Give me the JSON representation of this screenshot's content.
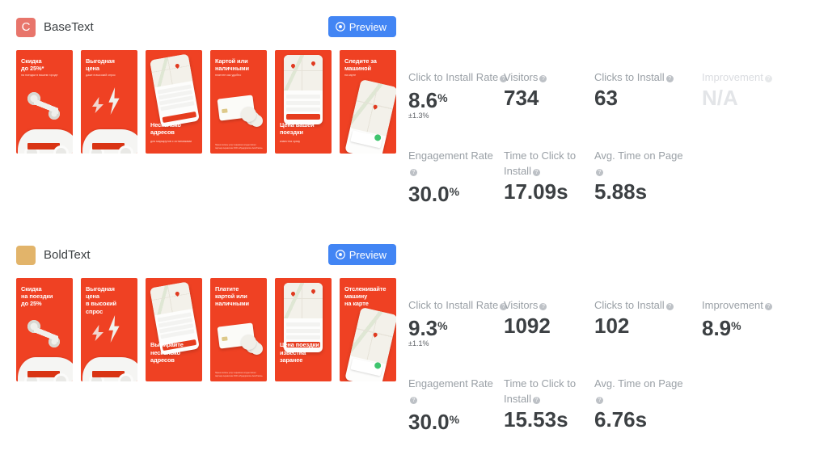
{
  "colors": {
    "accent_blue": "#4285f4",
    "label_gray": "#9aa0a6",
    "value_gray": "#3c4043",
    "na_gray": "#e3e5e8",
    "brand_red": "#ef4123",
    "avatar_base": "#e8756b",
    "avatar_bold": "#e2b46a"
  },
  "preview_label": "Preview",
  "qmark": "?",
  "variants": [
    {
      "id": "basetext",
      "name": "BaseText",
      "avatar_letter": "C",
      "avatar_color": "#e8756b",
      "shots": [
        {
          "headline": "Скидка\nдо 25%*",
          "sub": "на поездки в вашем городе",
          "pos": "top"
        },
        {
          "headline": "Выгодная\nцена",
          "sub": "даже в высокий спрос",
          "pos": "top"
        },
        {
          "headline": "Несколько\nадресов",
          "sub": "для маршрутов с остановками",
          "pos": "bottom"
        },
        {
          "headline": "Картой или\nналичными",
          "sub": "платите как удобно",
          "pos": "top",
          "legal": "Прием оплаты услуг перевозки осуществляет партнер-перевозчик ООО «Предприятие АвтоТакси»"
        },
        {
          "headline": "Цена вашей\nпоездки",
          "sub": "известна сразу",
          "pos": "bottom"
        },
        {
          "headline": "Следите за\nмашиной",
          "sub": "на карте",
          "pos": "top"
        }
      ],
      "metrics": [
        {
          "key": "click_to_install_rate",
          "label": "Click to Install Rate",
          "value": "8.6",
          "unit": "%",
          "error": "±1.3%",
          "wide": true,
          "na": false,
          "col": 0,
          "row": 0
        },
        {
          "key": "visitors",
          "label": "Visitors",
          "value": "734",
          "unit": "",
          "error": "",
          "wide": false,
          "na": false,
          "col": 1,
          "row": 0
        },
        {
          "key": "clicks_to_install",
          "label": "Clicks to Install",
          "value": "63",
          "unit": "",
          "error": "",
          "wide": false,
          "na": false,
          "col": 2,
          "row": 0
        },
        {
          "key": "improvement",
          "label": "Improvement",
          "value": "N/A",
          "unit": "",
          "error": "",
          "wide": true,
          "na": true,
          "col": 3,
          "row": 0
        },
        {
          "key": "engagement_rate",
          "label": "Engagement Rate",
          "value": "30.0",
          "unit": "%",
          "error": "",
          "wide": false,
          "na": false,
          "col": 0,
          "row": 1
        },
        {
          "key": "time_to_click_to_install",
          "label": "Time to Click to Install",
          "value": "17.09s",
          "unit": "",
          "error": "",
          "wide": false,
          "na": false,
          "col": 1,
          "row": 1
        },
        {
          "key": "avg_time_on_page",
          "label": "Avg. Time on Page",
          "value": "5.88s",
          "unit": "",
          "error": "",
          "wide": false,
          "na": false,
          "col": 2,
          "row": 1
        }
      ]
    },
    {
      "id": "boldtext",
      "name": "BoldText",
      "avatar_letter": "",
      "avatar_color": "#e2b46a",
      "shots": [
        {
          "headline": "Скидка\nна поездки\nдо 25%",
          "sub": "",
          "pos": "top"
        },
        {
          "headline": "Выгодная\nцена\nв высокий\nспрос",
          "sub": "",
          "pos": "top"
        },
        {
          "headline": "Выбирайте\nнесколько\nадресов",
          "sub": "",
          "pos": "bottom"
        },
        {
          "headline": "Платите\nкартой или\nналичными",
          "sub": "",
          "pos": "top",
          "legal": "Прием оплаты услуг перевозки осуществляет партнер-перевозчик ООО «Предприятие АвтоТакси»"
        },
        {
          "headline": "Цена поездки\nизвестна\nзаранее",
          "sub": "",
          "pos": "bottom"
        },
        {
          "headline": "Отслеживайте\nмашину\nна карте",
          "sub": "",
          "pos": "top"
        }
      ],
      "metrics": [
        {
          "key": "click_to_install_rate",
          "label": "Click to Install Rate",
          "value": "9.3",
          "unit": "%",
          "error": "±1.1%",
          "wide": true,
          "na": false,
          "col": 0,
          "row": 0
        },
        {
          "key": "visitors",
          "label": "Visitors",
          "value": "1092",
          "unit": "",
          "error": "",
          "wide": false,
          "na": false,
          "col": 1,
          "row": 0
        },
        {
          "key": "clicks_to_install",
          "label": "Clicks to Install",
          "value": "102",
          "unit": "",
          "error": "",
          "wide": false,
          "na": false,
          "col": 2,
          "row": 0
        },
        {
          "key": "improvement",
          "label": "Improvement",
          "value": "8.9",
          "unit": "%",
          "error": "",
          "wide": true,
          "na": false,
          "col": 3,
          "row": 0
        },
        {
          "key": "engagement_rate",
          "label": "Engagement Rate",
          "value": "30.0",
          "unit": "%",
          "error": "",
          "wide": false,
          "na": false,
          "col": 0,
          "row": 1
        },
        {
          "key": "time_to_click_to_install",
          "label": "Time to Click to Install",
          "value": "15.53s",
          "unit": "",
          "error": "",
          "wide": false,
          "na": false,
          "col": 1,
          "row": 1
        },
        {
          "key": "avg_time_on_page",
          "label": "Avg. Time on Page",
          "value": "6.76s",
          "unit": "",
          "error": "",
          "wide": false,
          "na": false,
          "col": 2,
          "row": 1
        }
      ]
    }
  ]
}
